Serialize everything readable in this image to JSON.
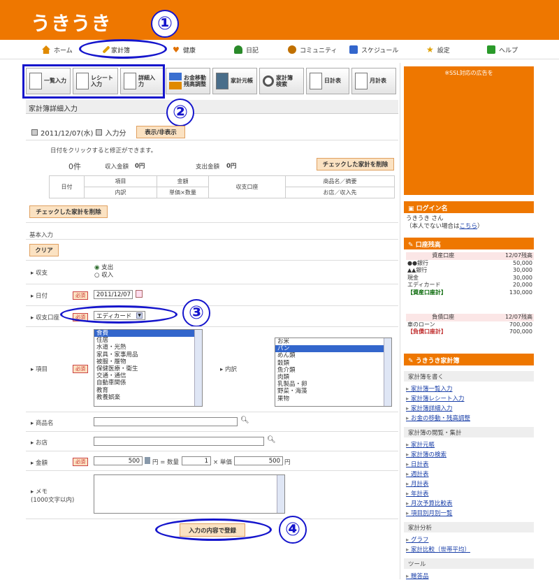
{
  "app": {
    "logo": "うきうき"
  },
  "nav": [
    {
      "label": "ホーム",
      "icon": "home-icon",
      "color": "#e08a00"
    },
    {
      "label": "家計簿",
      "icon": "pencil-icon",
      "color": "#e0a000"
    },
    {
      "label": "健康",
      "icon": "heart-icon",
      "color": "#e07000"
    },
    {
      "label": "日記",
      "icon": "person-icon",
      "color": "#2a8a2a"
    },
    {
      "label": "コミュニティ",
      "icon": "people-icon",
      "color": "#c07000"
    },
    {
      "label": "スケジュール",
      "icon": "calendar-icon",
      "color": "#3366cc"
    },
    {
      "label": "設定",
      "icon": "star-icon",
      "color": "#e0a000"
    },
    {
      "label": "ヘルプ",
      "icon": "help-icon",
      "color": "#2a9a2a"
    }
  ],
  "annotations": [
    "①",
    "②",
    "③",
    "④"
  ],
  "toolbar": [
    {
      "label": "一覧入力",
      "icon": "list-input-icon"
    },
    {
      "label": "レシート入力",
      "icon": "receipt-input-icon"
    },
    {
      "label": "詳細入力",
      "icon": "detail-input-icon"
    },
    {
      "label": "お金移動\n残高調整",
      "icon": "transfer-arrows-icon"
    },
    {
      "label": "家計元帳",
      "icon": "ledger-icon"
    },
    {
      "label": "家計簿\n検索",
      "icon": "magnifier-icon"
    },
    {
      "label": "日計表",
      "icon": "daily-sheet-icon"
    },
    {
      "label": "月計表",
      "icon": "monthly-sheet-icon"
    }
  ],
  "section": {
    "title": "家計簿詳細入力",
    "date_line": "2011/12/07(水)",
    "date_suffix": "入力分",
    "toggle_button": "表示/非表示",
    "hint": "日付をクリックすると修正ができます。",
    "count": "0件",
    "income_label": "収入金額",
    "income_value": "0円",
    "expense_label": "支出金額",
    "expense_value": "0円",
    "delete_checked": "チェックした家計を削除",
    "table": {
      "date": "日付",
      "item": "項目",
      "amount": "金額",
      "account": "収支口座",
      "product": "商品名／摘要",
      "breakdown": "内訳",
      "unit": "単価×数量",
      "shop": "お店／収入先"
    }
  },
  "form": {
    "basic_title": "基本入力",
    "clear": "クリア",
    "required": "必須",
    "type_label": "収支",
    "type_options": [
      "支出",
      "収入"
    ],
    "date_label": "日付",
    "date_value": "2011/12/07",
    "account_label": "収支口座",
    "account_value": "エディカード",
    "item_label": "項目",
    "items": [
      "食費",
      "住居",
      "水道・光熱",
      "家具・家事用品",
      "被服・履物",
      "保健医療・衛生",
      "交通・通信",
      "自動車関係",
      "教育",
      "教養娯楽"
    ],
    "breakdown_label": "内訳",
    "breakdowns": [
      "お米",
      "パン",
      "めん類",
      "穀類",
      "魚介類",
      "肉類",
      "乳製品・卵",
      "野菜・海藻",
      "果物"
    ],
    "product_label": "商品名",
    "shop_label": "お店",
    "amount_label": "金額",
    "amount_value": "500",
    "yen": "円",
    "eq_qty": "円 = 数量",
    "qty_value": "1",
    "times_unit": "× 単価",
    "unit_value": "500",
    "memo_label": "メモ",
    "memo_hint": "(1000文字以内)",
    "submit": "入力の内容で登録"
  },
  "sidebar": {
    "ad": "※SSL対応の広告を",
    "login_head": "ログイン名",
    "login_name": "うきうき さん",
    "login_note_pre": "（本人でない場合は",
    "login_note_link": "こちら",
    "login_note_post": "）",
    "balance_head": "口座残高",
    "asset_header": [
      "資産口座",
      "12/07残高"
    ],
    "assets": [
      [
        "●●銀行",
        "50,000"
      ],
      [
        "▲▲銀行",
        "30,000"
      ],
      [
        "現金",
        "30,000"
      ],
      [
        "エディカード",
        "20,000"
      ]
    ],
    "asset_total": [
      "【資産口座計】",
      "130,000"
    ],
    "debt_header": [
      "負債口座",
      "12/07残高"
    ],
    "debts": [
      [
        "車のローン",
        "700,000"
      ]
    ],
    "debt_total": [
      "【負債口座計】",
      "700,000"
    ],
    "book_head": "うきうき家計簿",
    "sub_write": "家計簿を書く",
    "links_write": [
      "家計簿一覧入力",
      "家計簿レシート入力",
      "家計簿詳細入力",
      "お金の移動・残高調整"
    ],
    "sub_view": "家計簿の閲覧・集計",
    "links_view": [
      "家計元帳",
      "家計簿の検索",
      "日計表",
      "週計表",
      "月計表",
      "年計表",
      "月次予算比較表",
      "項目別月別一覧"
    ],
    "sub_analysis": "家計分析",
    "links_analysis": [
      "グラフ",
      "家計比較（世帯平均）"
    ],
    "sub_tools": "ツール",
    "links_tools": [
      "贈答品"
    ]
  }
}
